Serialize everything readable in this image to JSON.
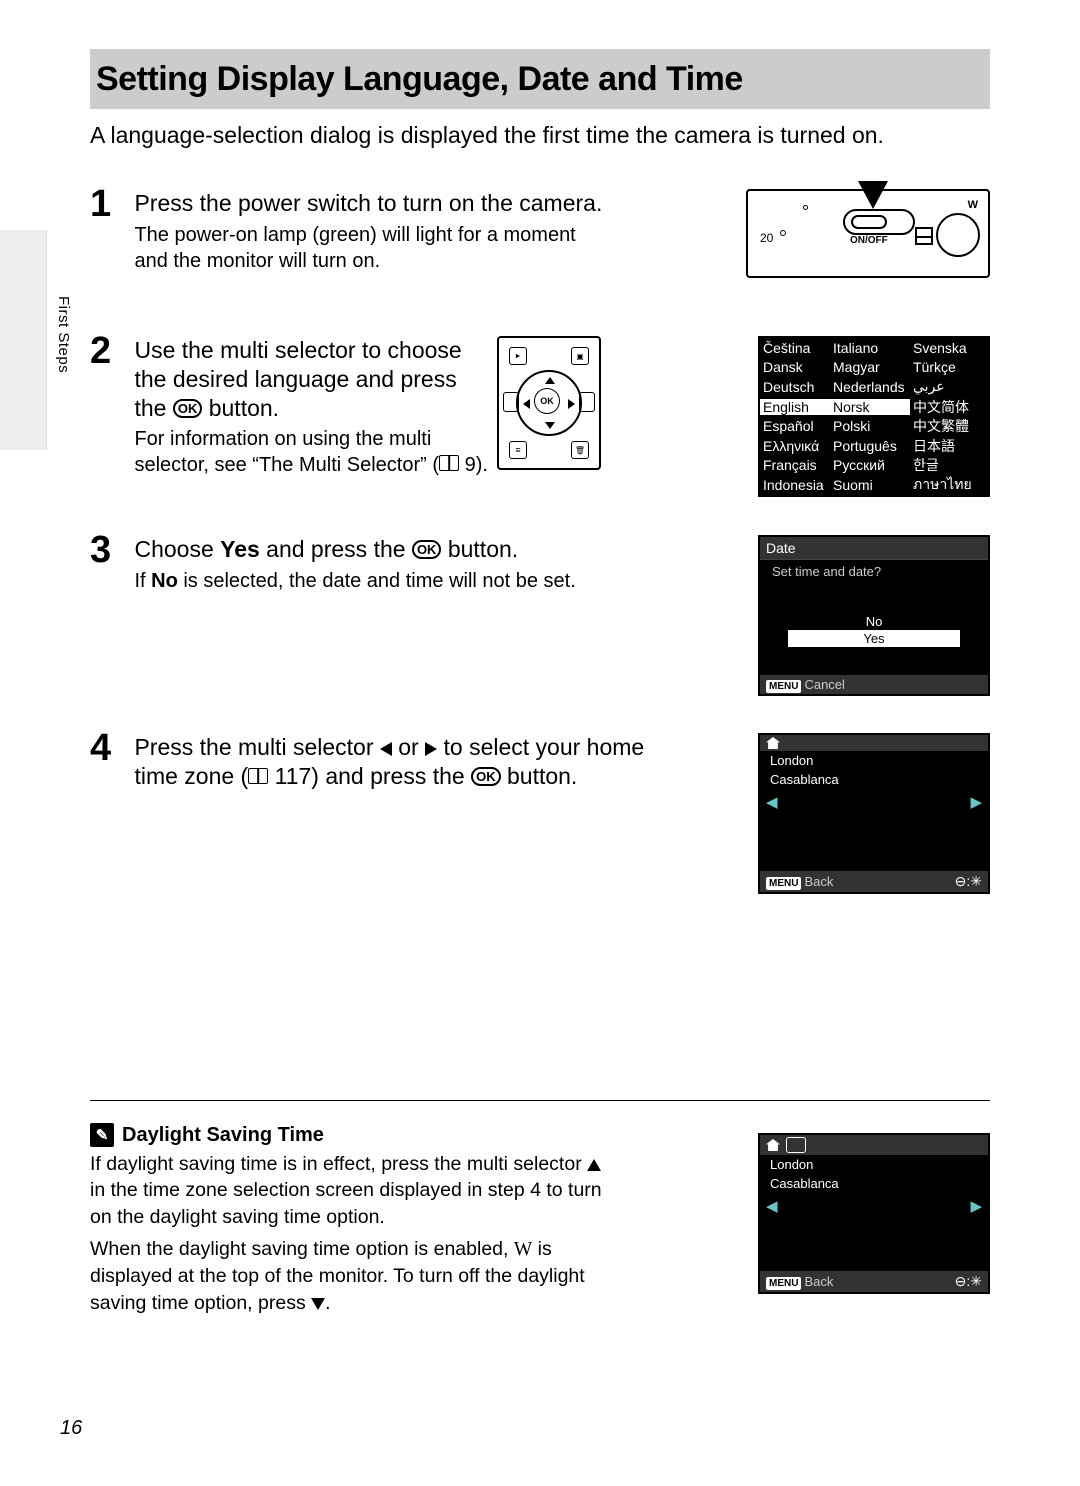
{
  "page_number": "16",
  "side_label": "First Steps",
  "title": "Setting Display Language, Date and Time",
  "intro": "A language-selection dialog is displayed the first time the camera is turned on.",
  "steps": {
    "s1_num": "1",
    "s1_head": "Press the power switch to turn on the camera.",
    "s1_sub": "The power-on lamp (green) will light for a moment and the monitor will turn on.",
    "s2_num": "2",
    "s2_head_a": "Use the multi selector to choose the desired language and press the ",
    "s2_head_b": " button.",
    "s2_sub_a": "For information on using the multi selector, see “The Multi Selector” (",
    "s2_sub_b": " 9).",
    "s3_num": "3",
    "s3_head_a": "Choose ",
    "s3_head_b": "Yes",
    "s3_head_c": " and press the ",
    "s3_head_d": " button.",
    "s3_sub_a": "If ",
    "s3_sub_b": "No",
    "s3_sub_c": " is selected, the date and time will not be set.",
    "s4_num": "4",
    "s4_head_a": "Press the multi selector ",
    "s4_head_b": " or ",
    "s4_head_c": " to select your home time zone (",
    "s4_head_d": " 117) and press the ",
    "s4_head_e": " button."
  },
  "camera_illus": {
    "label_20": "20",
    "label_onoff": "ON/OFF",
    "label_w": "W"
  },
  "ms_illus": {
    "ok": "OK"
  },
  "lang_screen": {
    "col1": [
      "Čeština",
      "Dansk",
      "Deutsch",
      "English",
      "Español",
      "Ελληνικά",
      "Français",
      "Indonesia"
    ],
    "col2": [
      "Italiano",
      "Magyar",
      "Nederlands",
      "Norsk",
      "Polski",
      "Português",
      "Русский",
      "Suomi"
    ],
    "col3": [
      "Svenska",
      "Türkçe",
      "عربي",
      "中文简体",
      "中文繁體",
      "日本語",
      "한글",
      "ภาษาไทย"
    ]
  },
  "date_screen": {
    "title": "Date",
    "question": "Set time and date?",
    "opt_no": "No",
    "opt_yes": "Yes",
    "menu": "MENU",
    "cancel": "Cancel"
  },
  "tz_screen": {
    "city1": "London",
    "city2": "Casablanca",
    "menu": "MENU",
    "back": "Back",
    "arrow_l": "◀",
    "arrow_r": "▶"
  },
  "dst": {
    "heading": "Daylight Saving Time",
    "p1_a": "If daylight saving time is in effect, press the multi selector ",
    "p1_b": " in the time zone selection screen displayed in step 4 to turn on the daylight saving time option.",
    "p2_a": "When the daylight saving time option is enabled, ",
    "p2_b": "W",
    "p2_c": " is displayed at the top of the monitor. To turn off the daylight saving time option, press ",
    "p2_d": "."
  },
  "ok_label": "OK"
}
